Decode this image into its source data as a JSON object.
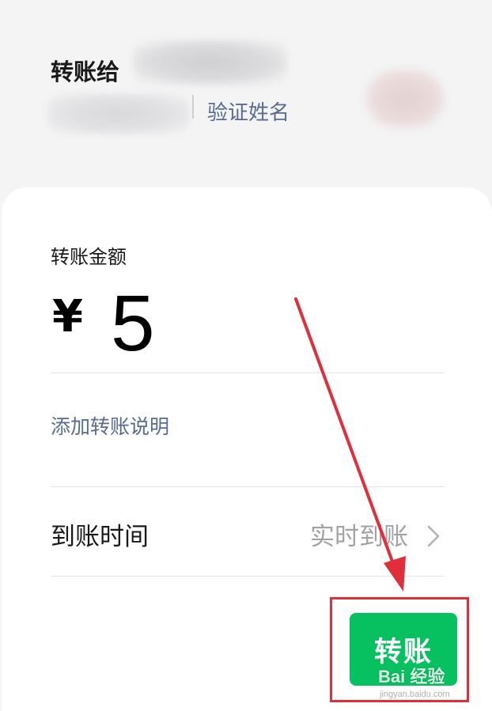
{
  "header": {
    "title": "转账给",
    "verify_link": "验证姓名"
  },
  "amount": {
    "label": "转账金额",
    "currency": "¥",
    "value": "5"
  },
  "note": {
    "add_label": "添加转账说明"
  },
  "arrival": {
    "label": "到账时间",
    "value": "实时到账"
  },
  "action": {
    "transfer_label": "转账"
  },
  "watermark": {
    "text": "Bai 经验",
    "sub": "jingyan.baidu.com"
  },
  "colors": {
    "accent_green": "#07c160",
    "link_blue": "#576b95",
    "annotation_red": "#e02f3a"
  }
}
